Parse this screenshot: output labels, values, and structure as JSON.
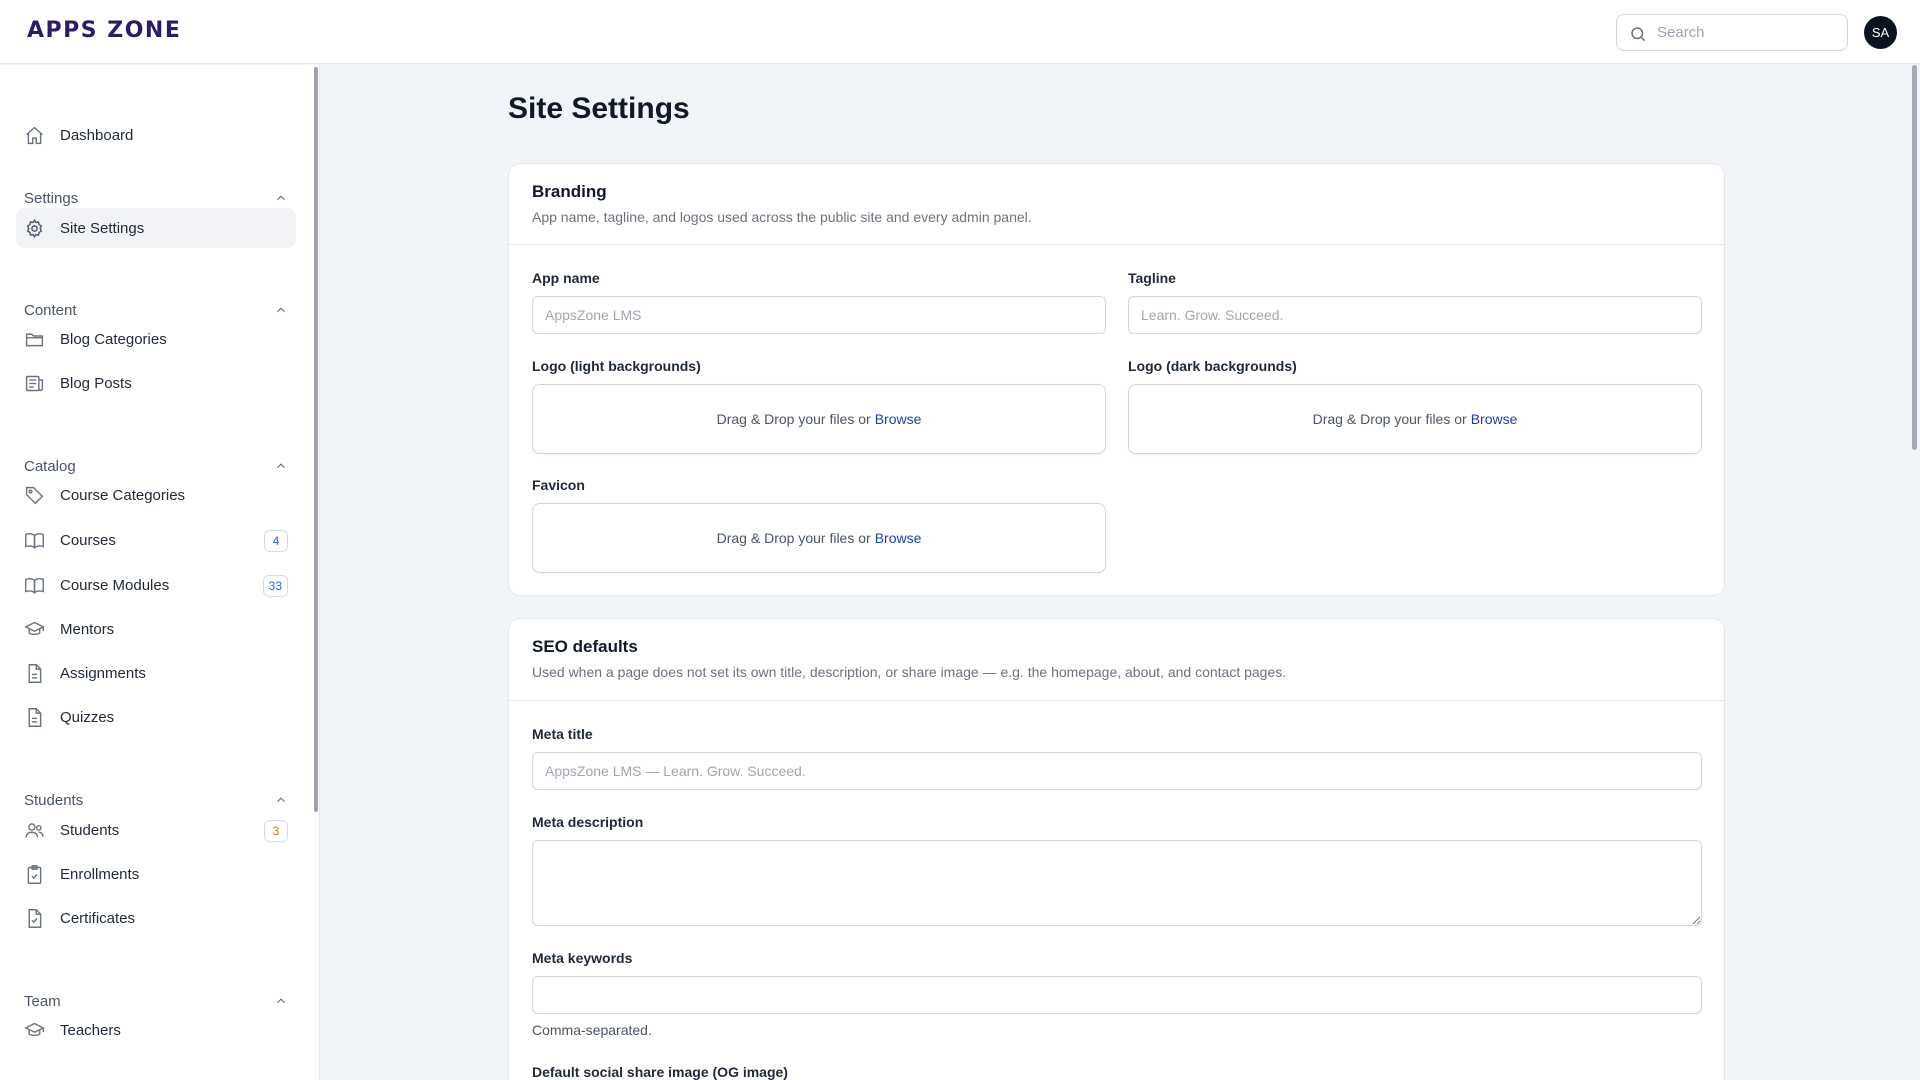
{
  "app": {
    "logo_text": "APPS ZONE"
  },
  "header": {
    "search_placeholder": "Search",
    "avatar_initials": "SA"
  },
  "sidebar": {
    "dashboard": "Dashboard",
    "groups": {
      "settings": "Settings",
      "content": "Content",
      "catalog": "Catalog",
      "students": "Students",
      "team": "Team"
    },
    "items": {
      "site_settings": "Site Settings",
      "blog_categories": "Blog Categories",
      "blog_posts": "Blog Posts",
      "course_categories": "Course Categories",
      "courses": "Courses",
      "course_modules": "Course Modules",
      "mentors": "Mentors",
      "assignments": "Assignments",
      "quizzes": "Quizzes",
      "students": "Students",
      "enrollments": "Enrollments",
      "certificates": "Certificates",
      "teachers": "Teachers"
    },
    "badges": {
      "courses": "4",
      "course_modules": "33",
      "students": "3"
    },
    "badge_colors": {
      "courses": "#2563eb",
      "course_modules": "#2563eb",
      "students": "#d97706"
    }
  },
  "page": {
    "title": "Site Settings"
  },
  "branding": {
    "title": "Branding",
    "description": "App name, tagline, and logos used across the public site and every admin panel.",
    "app_name_label": "App name",
    "app_name_placeholder": "AppsZone LMS",
    "tagline_label": "Tagline",
    "tagline_placeholder": "Learn. Grow. Succeed.",
    "logo_light_label": "Logo (light backgrounds)",
    "logo_dark_label": "Logo (dark backgrounds)",
    "favicon_label": "Favicon",
    "dropzone_text": "Drag & Drop your files or",
    "browse_text": "Browse"
  },
  "seo": {
    "title": "SEO defaults",
    "description": "Used when a page does not set its own title, description, or share image — e.g. the homepage, about, and contact pages.",
    "meta_title_label": "Meta title",
    "meta_title_placeholder": "AppsZone LMS — Learn. Grow. Succeed.",
    "meta_description_label": "Meta description",
    "meta_keywords_label": "Meta keywords",
    "meta_keywords_help": "Comma-separated.",
    "og_image_label": "Default social share image (OG image)"
  },
  "colors": {
    "brand": "#2e1a6b",
    "link": "#1e40af",
    "avatar_bg": "#0b1220"
  }
}
